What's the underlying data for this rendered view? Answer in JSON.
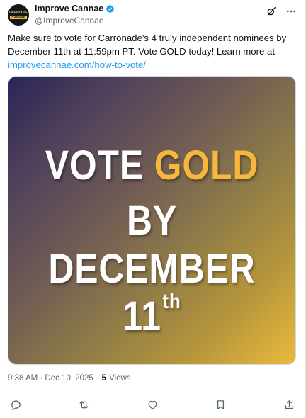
{
  "account": {
    "display_name": "Improve Cannae",
    "handle": "@ImproveCannae",
    "avatar_line1": "IMPROVE",
    "avatar_line2": "CANNAE",
    "verified_color": "#1d9bf0"
  },
  "tweet": {
    "text": "Make sure to vote for Carronade's 4 truly independent nominees by December 11th at 11:59pm PT. Vote GOLD today! Learn more at ",
    "link": "improvecannae.com/how-to-vote/",
    "link_color": "#1d9bf0"
  },
  "media": {
    "line1_part1": "VOTE ",
    "line1_part2": "GOLD",
    "line2": "BY",
    "line3": "DECEMBER 11",
    "line3_sup": "th",
    "gold_color": "#f6b73c"
  },
  "meta": {
    "timestamp": "9:38 AM · Dec 10, 2025",
    "separator": "·",
    "views_count": "5",
    "views_label": "Views"
  },
  "icons": {
    "top": [
      "grok-icon",
      "more-icon"
    ],
    "actions": [
      "reply-icon",
      "repost-icon",
      "like-icon",
      "bookmark-icon",
      "share-icon"
    ]
  }
}
